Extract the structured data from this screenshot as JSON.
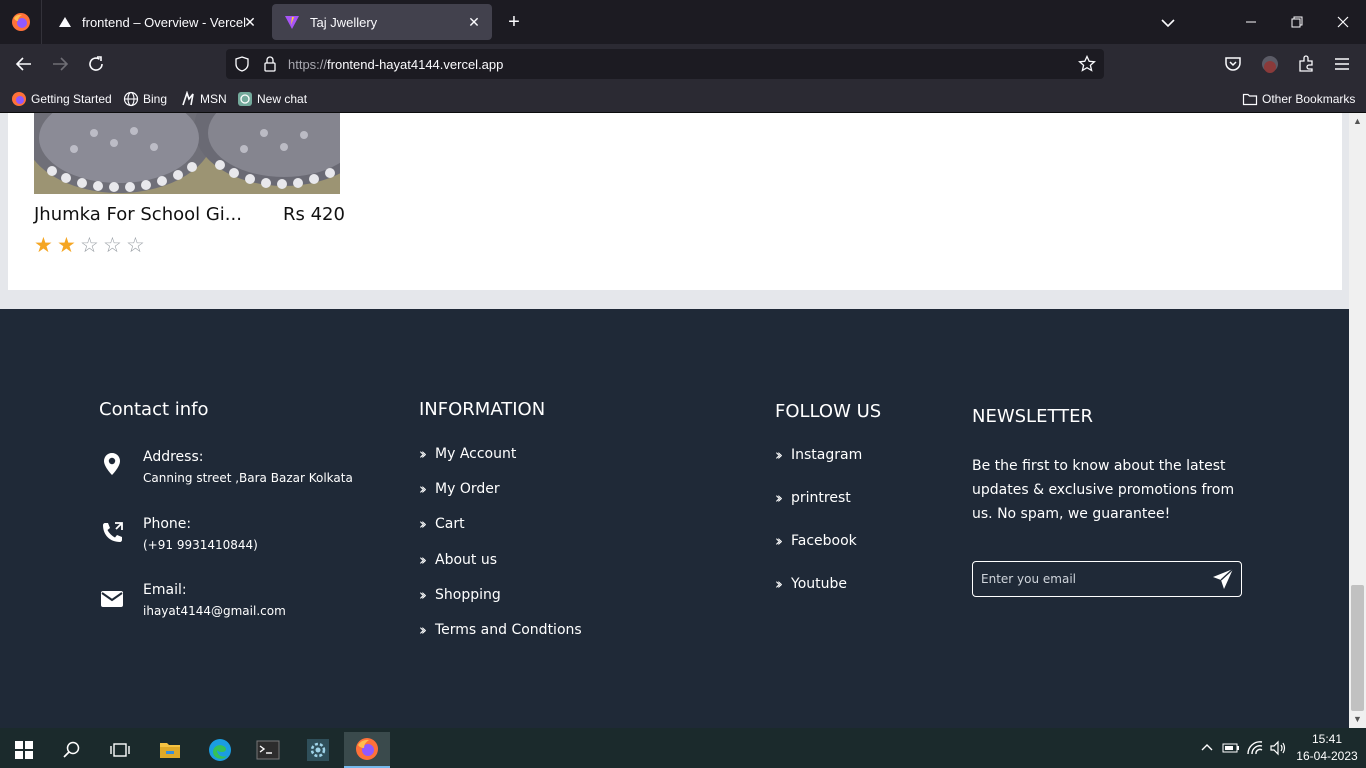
{
  "browser": {
    "tabs": [
      {
        "title": "frontend – Overview - Vercel",
        "close": "✕"
      },
      {
        "title": "Taj Jwellery",
        "close": "✕"
      }
    ],
    "new_tab": "+",
    "window_controls": {
      "minimize": "—",
      "restore": "❐",
      "close": "✕"
    },
    "url": {
      "scheme": "https://",
      "host": "frontend-hayat4144.vercel.app"
    },
    "bookmarks": [
      "Getting Started",
      "Bing",
      "MSN",
      "New chat"
    ],
    "other_bookmarks": "Other Bookmarks"
  },
  "product": {
    "name": "Jhumka For School Gi...",
    "price": "Rs 420",
    "rating": 2,
    "max_rating": 5
  },
  "footer": {
    "contact": {
      "heading": "Contact info",
      "items": [
        {
          "label": "Address:",
          "value": "Canning street ,Bara Bazar Kolkata",
          "icon": "location-pin-icon"
        },
        {
          "label": "Phone:",
          "value": "(+91 9931410844)",
          "icon": "phone-icon"
        },
        {
          "label": "Email:",
          "value": "ihayat4144@gmail.com",
          "icon": "mail-icon"
        }
      ]
    },
    "information": {
      "heading": "INFORMATION",
      "links": [
        "My Account",
        "My Order",
        "Cart",
        "About us",
        "Shopping",
        "Terms and Condtions"
      ]
    },
    "follow": {
      "heading": "FOLLOW US",
      "links": [
        "Instagram",
        "printrest",
        "Facebook",
        "Youtube"
      ]
    },
    "newsletter": {
      "heading": "NEWSLETTER",
      "text": "Be the first to know about the latest updates & exclusive promotions from us. No spam, we guarantee!",
      "placeholder": "Enter you email"
    }
  },
  "taskbar": {
    "time": "15:41",
    "date": "16-04-2023"
  },
  "colors": {
    "footer_bg": "#1f2937",
    "page_bg": "#e5e7eb",
    "star": "#f5a623"
  }
}
